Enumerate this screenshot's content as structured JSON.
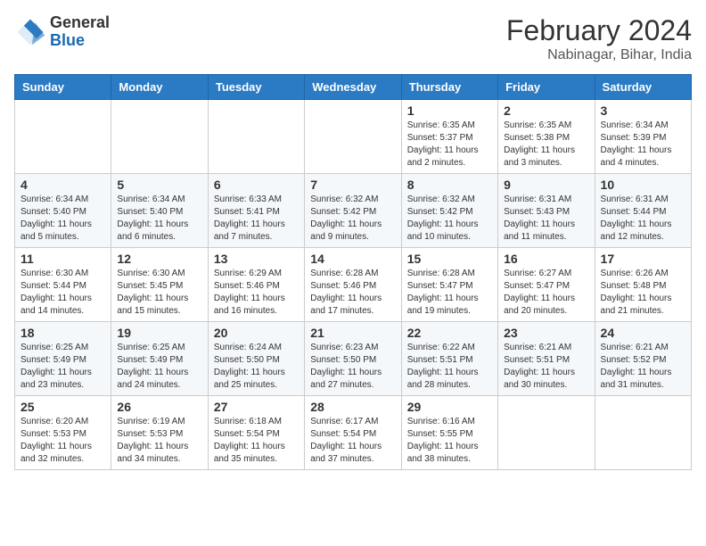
{
  "header": {
    "logo_general": "General",
    "logo_blue": "Blue",
    "title": "February 2024",
    "subtitle": "Nabinagar, Bihar, India"
  },
  "weekdays": [
    "Sunday",
    "Monday",
    "Tuesday",
    "Wednesday",
    "Thursday",
    "Friday",
    "Saturday"
  ],
  "rows": [
    [
      {
        "day": "",
        "info": ""
      },
      {
        "day": "",
        "info": ""
      },
      {
        "day": "",
        "info": ""
      },
      {
        "day": "",
        "info": ""
      },
      {
        "day": "1",
        "info": "Sunrise: 6:35 AM\nSunset: 5:37 PM\nDaylight: 11 hours and 2 minutes."
      },
      {
        "day": "2",
        "info": "Sunrise: 6:35 AM\nSunset: 5:38 PM\nDaylight: 11 hours and 3 minutes."
      },
      {
        "day": "3",
        "info": "Sunrise: 6:34 AM\nSunset: 5:39 PM\nDaylight: 11 hours and 4 minutes."
      }
    ],
    [
      {
        "day": "4",
        "info": "Sunrise: 6:34 AM\nSunset: 5:40 PM\nDaylight: 11 hours and 5 minutes."
      },
      {
        "day": "5",
        "info": "Sunrise: 6:34 AM\nSunset: 5:40 PM\nDaylight: 11 hours and 6 minutes."
      },
      {
        "day": "6",
        "info": "Sunrise: 6:33 AM\nSunset: 5:41 PM\nDaylight: 11 hours and 7 minutes."
      },
      {
        "day": "7",
        "info": "Sunrise: 6:32 AM\nSunset: 5:42 PM\nDaylight: 11 hours and 9 minutes."
      },
      {
        "day": "8",
        "info": "Sunrise: 6:32 AM\nSunset: 5:42 PM\nDaylight: 11 hours and 10 minutes."
      },
      {
        "day": "9",
        "info": "Sunrise: 6:31 AM\nSunset: 5:43 PM\nDaylight: 11 hours and 11 minutes."
      },
      {
        "day": "10",
        "info": "Sunrise: 6:31 AM\nSunset: 5:44 PM\nDaylight: 11 hours and 12 minutes."
      }
    ],
    [
      {
        "day": "11",
        "info": "Sunrise: 6:30 AM\nSunset: 5:44 PM\nDaylight: 11 hours and 14 minutes."
      },
      {
        "day": "12",
        "info": "Sunrise: 6:30 AM\nSunset: 5:45 PM\nDaylight: 11 hours and 15 minutes."
      },
      {
        "day": "13",
        "info": "Sunrise: 6:29 AM\nSunset: 5:46 PM\nDaylight: 11 hours and 16 minutes."
      },
      {
        "day": "14",
        "info": "Sunrise: 6:28 AM\nSunset: 5:46 PM\nDaylight: 11 hours and 17 minutes."
      },
      {
        "day": "15",
        "info": "Sunrise: 6:28 AM\nSunset: 5:47 PM\nDaylight: 11 hours and 19 minutes."
      },
      {
        "day": "16",
        "info": "Sunrise: 6:27 AM\nSunset: 5:47 PM\nDaylight: 11 hours and 20 minutes."
      },
      {
        "day": "17",
        "info": "Sunrise: 6:26 AM\nSunset: 5:48 PM\nDaylight: 11 hours and 21 minutes."
      }
    ],
    [
      {
        "day": "18",
        "info": "Sunrise: 6:25 AM\nSunset: 5:49 PM\nDaylight: 11 hours and 23 minutes."
      },
      {
        "day": "19",
        "info": "Sunrise: 6:25 AM\nSunset: 5:49 PM\nDaylight: 11 hours and 24 minutes."
      },
      {
        "day": "20",
        "info": "Sunrise: 6:24 AM\nSunset: 5:50 PM\nDaylight: 11 hours and 25 minutes."
      },
      {
        "day": "21",
        "info": "Sunrise: 6:23 AM\nSunset: 5:50 PM\nDaylight: 11 hours and 27 minutes."
      },
      {
        "day": "22",
        "info": "Sunrise: 6:22 AM\nSunset: 5:51 PM\nDaylight: 11 hours and 28 minutes."
      },
      {
        "day": "23",
        "info": "Sunrise: 6:21 AM\nSunset: 5:51 PM\nDaylight: 11 hours and 30 minutes."
      },
      {
        "day": "24",
        "info": "Sunrise: 6:21 AM\nSunset: 5:52 PM\nDaylight: 11 hours and 31 minutes."
      }
    ],
    [
      {
        "day": "25",
        "info": "Sunrise: 6:20 AM\nSunset: 5:53 PM\nDaylight: 11 hours and 32 minutes."
      },
      {
        "day": "26",
        "info": "Sunrise: 6:19 AM\nSunset: 5:53 PM\nDaylight: 11 hours and 34 minutes."
      },
      {
        "day": "27",
        "info": "Sunrise: 6:18 AM\nSunset: 5:54 PM\nDaylight: 11 hours and 35 minutes."
      },
      {
        "day": "28",
        "info": "Sunrise: 6:17 AM\nSunset: 5:54 PM\nDaylight: 11 hours and 37 minutes."
      },
      {
        "day": "29",
        "info": "Sunrise: 6:16 AM\nSunset: 5:55 PM\nDaylight: 11 hours and 38 minutes."
      },
      {
        "day": "",
        "info": ""
      },
      {
        "day": "",
        "info": ""
      }
    ]
  ]
}
